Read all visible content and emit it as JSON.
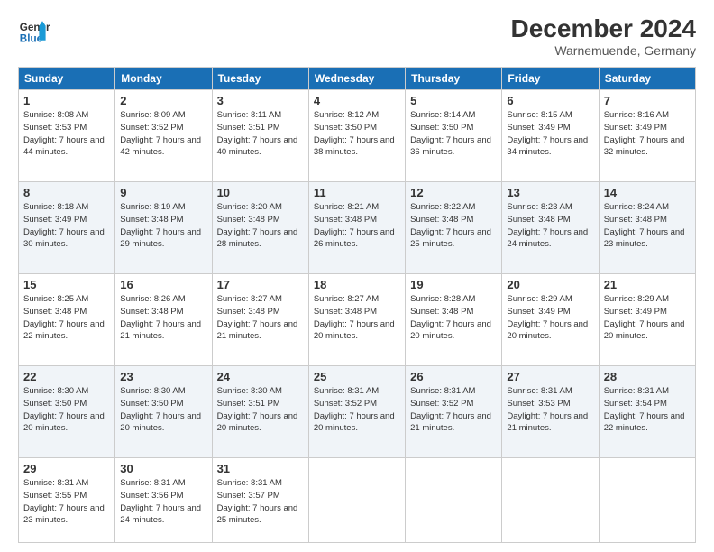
{
  "header": {
    "logo_line1": "General",
    "logo_line2": "Blue",
    "month_title": "December 2024",
    "location": "Warnemuende, Germany"
  },
  "weekdays": [
    "Sunday",
    "Monday",
    "Tuesday",
    "Wednesday",
    "Thursday",
    "Friday",
    "Saturday"
  ],
  "weeks": [
    [
      {
        "day": "1",
        "sunrise": "8:08 AM",
        "sunset": "3:53 PM",
        "daylight": "7 hours and 44 minutes."
      },
      {
        "day": "2",
        "sunrise": "8:09 AM",
        "sunset": "3:52 PM",
        "daylight": "7 hours and 42 minutes."
      },
      {
        "day": "3",
        "sunrise": "8:11 AM",
        "sunset": "3:51 PM",
        "daylight": "7 hours and 40 minutes."
      },
      {
        "day": "4",
        "sunrise": "8:12 AM",
        "sunset": "3:50 PM",
        "daylight": "7 hours and 38 minutes."
      },
      {
        "day": "5",
        "sunrise": "8:14 AM",
        "sunset": "3:50 PM",
        "daylight": "7 hours and 36 minutes."
      },
      {
        "day": "6",
        "sunrise": "8:15 AM",
        "sunset": "3:49 PM",
        "daylight": "7 hours and 34 minutes."
      },
      {
        "day": "7",
        "sunrise": "8:16 AM",
        "sunset": "3:49 PM",
        "daylight": "7 hours and 32 minutes."
      }
    ],
    [
      {
        "day": "8",
        "sunrise": "8:18 AM",
        "sunset": "3:49 PM",
        "daylight": "7 hours and 30 minutes."
      },
      {
        "day": "9",
        "sunrise": "8:19 AM",
        "sunset": "3:48 PM",
        "daylight": "7 hours and 29 minutes."
      },
      {
        "day": "10",
        "sunrise": "8:20 AM",
        "sunset": "3:48 PM",
        "daylight": "7 hours and 28 minutes."
      },
      {
        "day": "11",
        "sunrise": "8:21 AM",
        "sunset": "3:48 PM",
        "daylight": "7 hours and 26 minutes."
      },
      {
        "day": "12",
        "sunrise": "8:22 AM",
        "sunset": "3:48 PM",
        "daylight": "7 hours and 25 minutes."
      },
      {
        "day": "13",
        "sunrise": "8:23 AM",
        "sunset": "3:48 PM",
        "daylight": "7 hours and 24 minutes."
      },
      {
        "day": "14",
        "sunrise": "8:24 AM",
        "sunset": "3:48 PM",
        "daylight": "7 hours and 23 minutes."
      }
    ],
    [
      {
        "day": "15",
        "sunrise": "8:25 AM",
        "sunset": "3:48 PM",
        "daylight": "7 hours and 22 minutes."
      },
      {
        "day": "16",
        "sunrise": "8:26 AM",
        "sunset": "3:48 PM",
        "daylight": "7 hours and 21 minutes."
      },
      {
        "day": "17",
        "sunrise": "8:27 AM",
        "sunset": "3:48 PM",
        "daylight": "7 hours and 21 minutes."
      },
      {
        "day": "18",
        "sunrise": "8:27 AM",
        "sunset": "3:48 PM",
        "daylight": "7 hours and 20 minutes."
      },
      {
        "day": "19",
        "sunrise": "8:28 AM",
        "sunset": "3:48 PM",
        "daylight": "7 hours and 20 minutes."
      },
      {
        "day": "20",
        "sunrise": "8:29 AM",
        "sunset": "3:49 PM",
        "daylight": "7 hours and 20 minutes."
      },
      {
        "day": "21",
        "sunrise": "8:29 AM",
        "sunset": "3:49 PM",
        "daylight": "7 hours and 20 minutes."
      }
    ],
    [
      {
        "day": "22",
        "sunrise": "8:30 AM",
        "sunset": "3:50 PM",
        "daylight": "7 hours and 20 minutes."
      },
      {
        "day": "23",
        "sunrise": "8:30 AM",
        "sunset": "3:50 PM",
        "daylight": "7 hours and 20 minutes."
      },
      {
        "day": "24",
        "sunrise": "8:30 AM",
        "sunset": "3:51 PM",
        "daylight": "7 hours and 20 minutes."
      },
      {
        "day": "25",
        "sunrise": "8:31 AM",
        "sunset": "3:52 PM",
        "daylight": "7 hours and 20 minutes."
      },
      {
        "day": "26",
        "sunrise": "8:31 AM",
        "sunset": "3:52 PM",
        "daylight": "7 hours and 21 minutes."
      },
      {
        "day": "27",
        "sunrise": "8:31 AM",
        "sunset": "3:53 PM",
        "daylight": "7 hours and 21 minutes."
      },
      {
        "day": "28",
        "sunrise": "8:31 AM",
        "sunset": "3:54 PM",
        "daylight": "7 hours and 22 minutes."
      }
    ],
    [
      {
        "day": "29",
        "sunrise": "8:31 AM",
        "sunset": "3:55 PM",
        "daylight": "7 hours and 23 minutes."
      },
      {
        "day": "30",
        "sunrise": "8:31 AM",
        "sunset": "3:56 PM",
        "daylight": "7 hours and 24 minutes."
      },
      {
        "day": "31",
        "sunrise": "8:31 AM",
        "sunset": "3:57 PM",
        "daylight": "7 hours and 25 minutes."
      },
      null,
      null,
      null,
      null
    ]
  ],
  "labels": {
    "sunrise": "Sunrise:",
    "sunset": "Sunset:",
    "daylight": "Daylight:"
  }
}
